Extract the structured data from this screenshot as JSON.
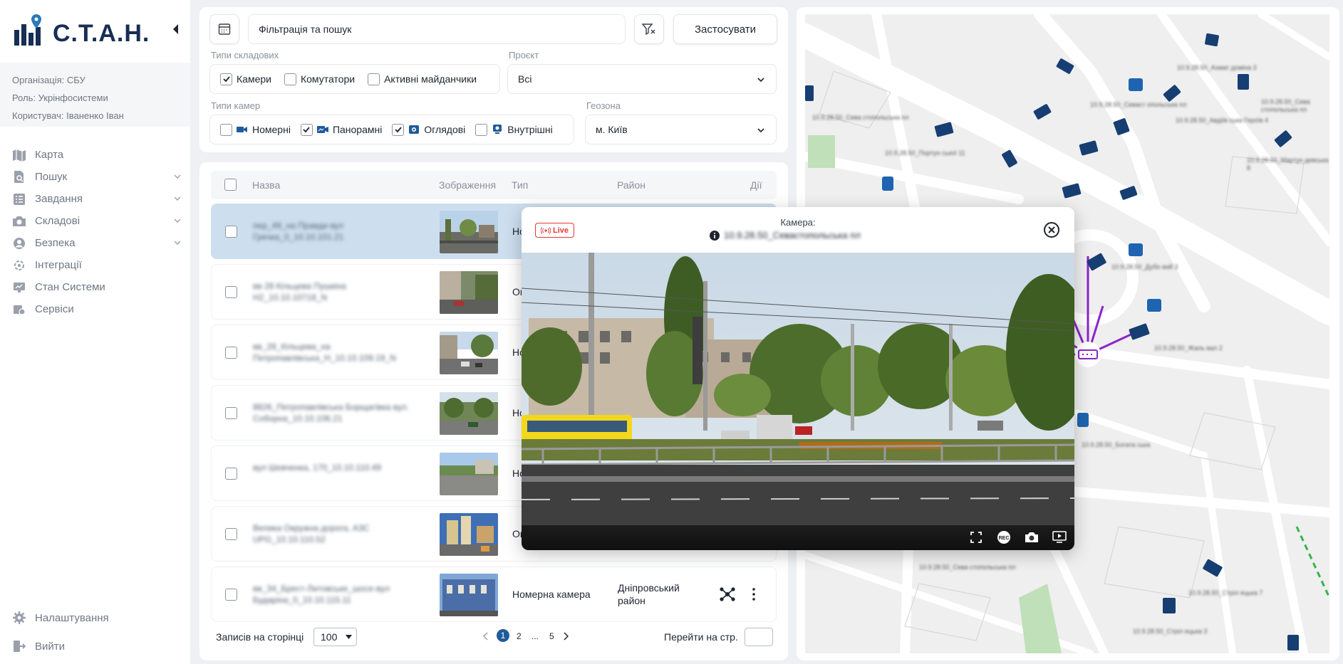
{
  "app": {
    "logo_text": "С.Т.А.Н."
  },
  "user": {
    "org": "Організація: СБУ",
    "role": "Роль: Укрінфосистеми",
    "name": "Користувач: Іваненко Іван"
  },
  "nav": [
    {
      "label": "Карта",
      "icon": "map-icon"
    },
    {
      "label": "Пошук",
      "icon": "search-doc-icon",
      "expandable": true
    },
    {
      "label": "Завдання",
      "icon": "tasks-icon",
      "expandable": true
    },
    {
      "label": "Складові",
      "icon": "camera-icon",
      "expandable": true
    },
    {
      "label": "Безпека",
      "icon": "user-shield-icon",
      "expandable": true
    },
    {
      "label": "Інтеграції",
      "icon": "integration-icon"
    },
    {
      "label": "Стан Системи",
      "icon": "monitor-icon"
    },
    {
      "label": "Сервіси",
      "icon": "services-icon"
    }
  ],
  "bottom_nav": {
    "settings": "Налаштування",
    "logout": "Вийти"
  },
  "filters": {
    "search_label": "Фільтрація та пошук",
    "apply": "Застосувати",
    "component_types_label": "Типи складових",
    "component_types": [
      {
        "label": "Камери",
        "checked": true
      },
      {
        "label": "Комутатори",
        "checked": false
      },
      {
        "label": "Активні майданчики",
        "checked": false
      }
    ],
    "project_label": "Проєкт",
    "project_value": "Всі",
    "camera_types_label": "Типи камер",
    "camera_types": [
      {
        "label": "Номерні",
        "checked": false,
        "icon": "video-camera-icon"
      },
      {
        "label": "Панорамні",
        "checked": true,
        "icon": "panoramic-camera-icon"
      },
      {
        "label": "Оглядові",
        "checked": true,
        "icon": "overview-camera-icon"
      },
      {
        "label": "Внутрішні",
        "checked": false,
        "icon": "indoor-camera-icon"
      }
    ],
    "geozone_label": "Геозона",
    "geozone_value": "м. Київ"
  },
  "table": {
    "headers": {
      "name": "Назва",
      "image": "Зображення",
      "type": "Тип",
      "district": "Район",
      "actions": "Дії"
    },
    "rows": [
      {
        "name": "пер_49_на Правди вул Гречка_0_10.10.101.21",
        "type": "Номерна камера",
        "district": "",
        "selected": true
      },
      {
        "name": "вв 28 Кільцева Пушкіна Н2_10.10.10718_N",
        "type": "Оглядова камера",
        "district": "",
        "selected": false
      },
      {
        "name": "вв_28_Кільцева_на Петропавлівська_Н_10.10.109.19_N",
        "type": "Номерна камера",
        "district": "",
        "selected": false
      },
      {
        "name": "8826_Петропавлівська Борщагівка вул. Соборна_10.10.106.21",
        "type": "Номерна камера",
        "district": "",
        "selected": false
      },
      {
        "name": "вул Шевченка, 170_10.10.110.49",
        "type": "Номерна камера",
        "district": "",
        "selected": false
      },
      {
        "name": "Велика Окружна дорога, АЗС UPG_10.10.110.52",
        "type": "Оглядова камера",
        "district": "",
        "selected": false
      },
      {
        "name": "вв_34_Брест-Литовське_шосе-вул Бударіна_0_10.10.115.11",
        "type": "Номерна  камера",
        "district": "Дніпровський район",
        "selected": false
      }
    ]
  },
  "pagination": {
    "per_page_label": "Записів на сторінці",
    "per_page_value": "100",
    "pages": [
      "1",
      "2",
      "...",
      "5"
    ],
    "current": "1",
    "goto_label": "Перейти на стр."
  },
  "popup": {
    "live": "Live",
    "title": "Камера:",
    "camera_id": "10.9.28.50_Севастопольська пл",
    "controls": [
      "fullscreen-icon",
      "record-icon",
      "snapshot-icon",
      "playback-icon"
    ]
  },
  "map_labels": [
    "10.9.28.50_Ахмат доміна 3",
    "10.9.28.50_Севаст опольська пл",
    "10.9.28.50_Авдіїв ська Героїв 4",
    "10.9.28.50_Сева стопольська пл",
    "10.9.28.50_Портун ської 11",
    "10.9.28.50_Мартун девська 8",
    "10.9.28.50_Дубо вий 3",
    "10.9.28.50_Жаль вал 2",
    "10.9.28.50_Сева стопольська пл",
    "10.9.28.50_Богата ська",
    "10.9.28.50_Сева стопольська пл",
    "10.9.28.50_Стріл ецька 7",
    "10.9.28.50_Стріл ецька 3"
  ],
  "colors": {
    "brand": "#172e55",
    "accent": "#1f5b9a",
    "selected_row": "#cddfef",
    "link_line": "#8e24c9",
    "live": "#e53935"
  }
}
